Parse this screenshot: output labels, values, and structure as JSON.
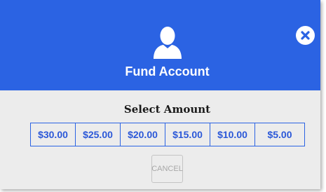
{
  "dialog": {
    "title": "Fund Account",
    "subtitle": "Select Amount",
    "header_icon": "user-icon",
    "close_icon": "close-icon",
    "accent_color": "#2b63e3",
    "background_color": "#ececec"
  },
  "amounts": [
    {
      "label": "$30.00"
    },
    {
      "label": "$25.00"
    },
    {
      "label": "$20.00"
    },
    {
      "label": "$15.00"
    },
    {
      "label": "$10.00"
    },
    {
      "label": "$5.00"
    }
  ],
  "actions": {
    "cancel_label": "CANCEL"
  }
}
